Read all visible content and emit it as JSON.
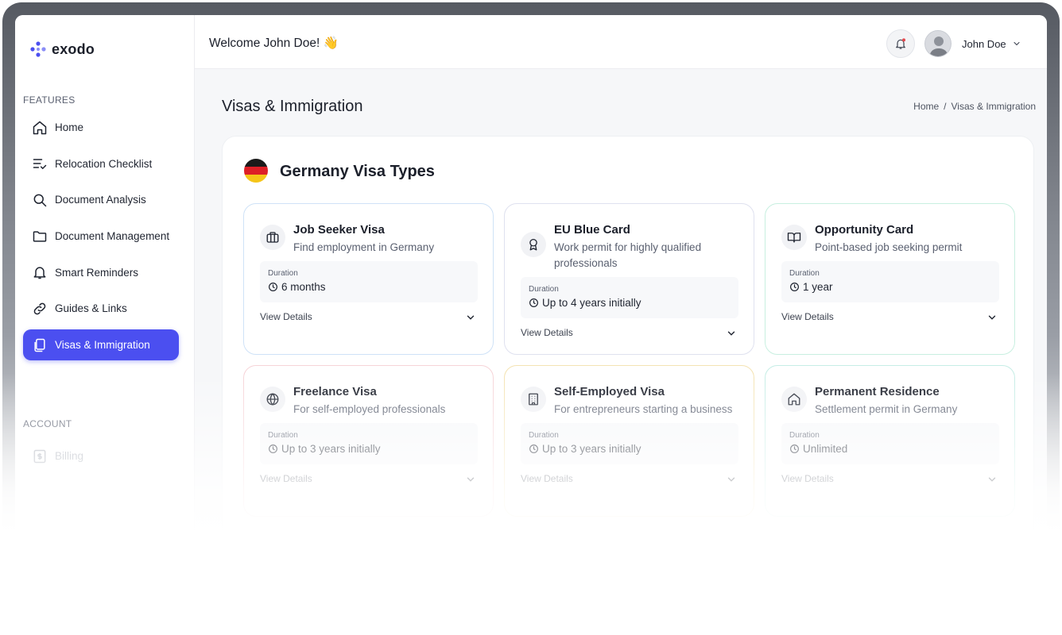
{
  "app": {
    "name": "exodo"
  },
  "sidebar": {
    "features_label": "FEATURES",
    "items": [
      {
        "label": "Home",
        "icon": "home-icon"
      },
      {
        "label": "Relocation Checklist",
        "icon": "checklist-icon"
      },
      {
        "label": "Document Analysis",
        "icon": "search-icon"
      },
      {
        "label": "Document Management",
        "icon": "folder-icon"
      },
      {
        "label": "Smart Reminders",
        "icon": "bell-icon"
      },
      {
        "label": "Guides & Links",
        "icon": "link-icon"
      },
      {
        "label": "Visas & Immigration",
        "icon": "documents-icon",
        "active": true
      }
    ],
    "account_label": "ACCOUNT",
    "account_items": [
      {
        "label": "Billing",
        "icon": "billing-icon"
      }
    ]
  },
  "header": {
    "welcome": "Welcome John Doe! 👋",
    "user_name": "John Doe"
  },
  "page": {
    "title": "Visas & Immigration",
    "breadcrumb": {
      "home": "Home",
      "separator": "/",
      "current": "Visas & Immigration"
    }
  },
  "panel": {
    "title": "Germany Visa Types",
    "flag_colors": [
      "#1a1a1a",
      "#dd1f26",
      "#f5c518"
    ]
  },
  "cards": [
    {
      "title": "Job Seeker Visa",
      "description": "Find employment in Germany",
      "duration_label": "Duration",
      "duration": "6 months",
      "view_details": "View Details",
      "icon": "briefcase-icon",
      "border": "#cfe2f7"
    },
    {
      "title": "EU Blue Card",
      "description": "Work permit for highly qualified professionals",
      "duration_label": "Duration",
      "duration": "Up to 4 years initially",
      "view_details": "View Details",
      "icon": "award-icon",
      "border": "#dfe1ef"
    },
    {
      "title": "Opportunity Card",
      "description": "Point-based job seeking permit",
      "duration_label": "Duration",
      "duration": "1 year",
      "view_details": "View Details",
      "icon": "book-icon",
      "border": "#c8efe0"
    },
    {
      "title": "Freelance Visa",
      "description": "For self-employed professionals",
      "duration_label": "Duration",
      "duration": "Up to 3 years initially",
      "view_details": "View Details",
      "icon": "globe-icon",
      "border": "#f6d4d8"
    },
    {
      "title": "Self-Employed Visa",
      "description": "For entrepreneurs starting a business",
      "duration_label": "Duration",
      "duration": "Up to 3 years initially",
      "view_details": "View Details",
      "icon": "building-icon",
      "border": "#f4e3b3"
    },
    {
      "title": "Permanent Residence",
      "description": "Settlement permit in Germany",
      "duration_label": "Duration",
      "duration": "Unlimited",
      "view_details": "View Details",
      "icon": "house-icon",
      "border": "#c6ede6"
    }
  ]
}
